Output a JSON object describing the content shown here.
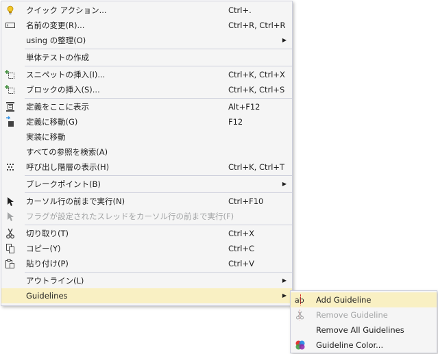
{
  "main_menu": {
    "items": [
      {
        "label": "クイック アクション...",
        "shortcut": "Ctrl+.",
        "icon": "lightbulb-icon"
      },
      {
        "label": "名前の変更(R)...",
        "shortcut": "Ctrl+R, Ctrl+R",
        "icon": "rename-icon"
      },
      {
        "label": "using の整理(O)",
        "shortcut": "",
        "submenu": true
      },
      {
        "label": "単体テストの作成",
        "shortcut": ""
      },
      {
        "label": "スニペットの挿入(I)...",
        "shortcut": "Ctrl+K, Ctrl+X",
        "icon": "insert-snippet-icon"
      },
      {
        "label": "ブロックの挿入(S)...",
        "shortcut": "Ctrl+K, Ctrl+S",
        "icon": "surround-with-icon"
      },
      {
        "label": "定義をここに表示",
        "shortcut": "Alt+F12",
        "icon": "peek-definition-icon"
      },
      {
        "label": "定義に移動(G)",
        "shortcut": "F12",
        "icon": "go-to-definition-icon"
      },
      {
        "label": "実装に移動",
        "shortcut": ""
      },
      {
        "label": "すべての参照を検索(A)",
        "shortcut": ""
      },
      {
        "label": "呼び出し階層の表示(H)",
        "shortcut": "Ctrl+K, Ctrl+T",
        "icon": "call-hierarchy-icon"
      },
      {
        "label": "ブレークポイント(B)",
        "shortcut": "",
        "submenu": true
      },
      {
        "label": "カーソル行の前まで実行(N)",
        "shortcut": "Ctrl+F10",
        "icon": "run-to-cursor-icon"
      },
      {
        "label": "フラグが設定されたスレッドをカーソル行の前まで実行(F)",
        "shortcut": "",
        "icon": "run-flagged-threads-icon",
        "disabled": true
      },
      {
        "label": "切り取り(T)",
        "shortcut": "Ctrl+X",
        "icon": "scissors-icon"
      },
      {
        "label": "コピー(Y)",
        "shortcut": "Ctrl+C",
        "icon": "copy-icon"
      },
      {
        "label": "貼り付け(P)",
        "shortcut": "Ctrl+V",
        "icon": "paste-icon"
      },
      {
        "label": "アウトライン(L)",
        "shortcut": "",
        "submenu": true
      },
      {
        "label": "Guidelines",
        "shortcut": "",
        "submenu": true,
        "highlighted": true
      }
    ]
  },
  "sub_menu": {
    "items": [
      {
        "label": "Add Guideline",
        "icon": "add-guideline-icon",
        "highlighted": true
      },
      {
        "label": "Remove Guideline",
        "icon": "remove-guideline-icon",
        "disabled": true
      },
      {
        "label": "Remove All Guidelines"
      },
      {
        "label": "Guideline Color...",
        "icon": "guideline-color-icon"
      }
    ]
  },
  "colors": {
    "menu_background": "#f5f5f5",
    "highlight": "#f9f0c3",
    "separator": "#cccedb",
    "disabled_text": "#a2a4a5"
  }
}
